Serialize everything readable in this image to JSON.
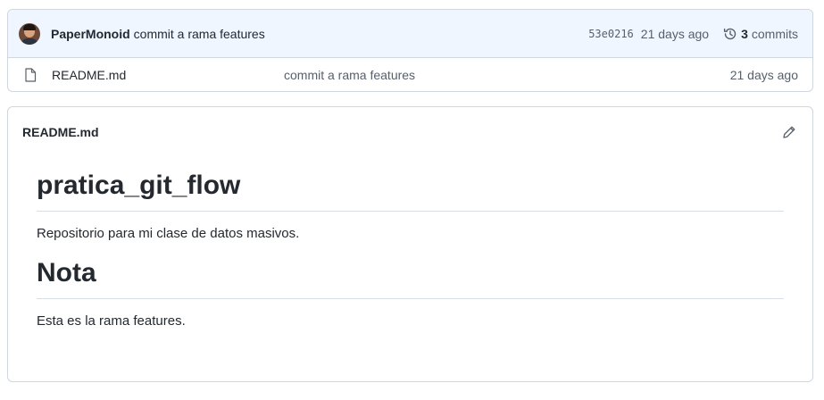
{
  "commit": {
    "author": "PaperMonoid",
    "message": "commit a rama features",
    "sha": "53e0216",
    "age": "21 days ago",
    "commit_count": "3",
    "commits_label": "commits"
  },
  "files": [
    {
      "name": "README.md",
      "message": "commit a rama features",
      "age": "21 days ago"
    }
  ],
  "readme": {
    "title": "README.md",
    "heading1": "pratica_git_flow",
    "paragraph1": "Repositorio para mi clase de datos masivos.",
    "heading2": "Nota",
    "paragraph2": "Esta es la rama features."
  },
  "icons": {
    "history": "history-icon",
    "file": "file-icon",
    "edit": "pencil-icon"
  }
}
